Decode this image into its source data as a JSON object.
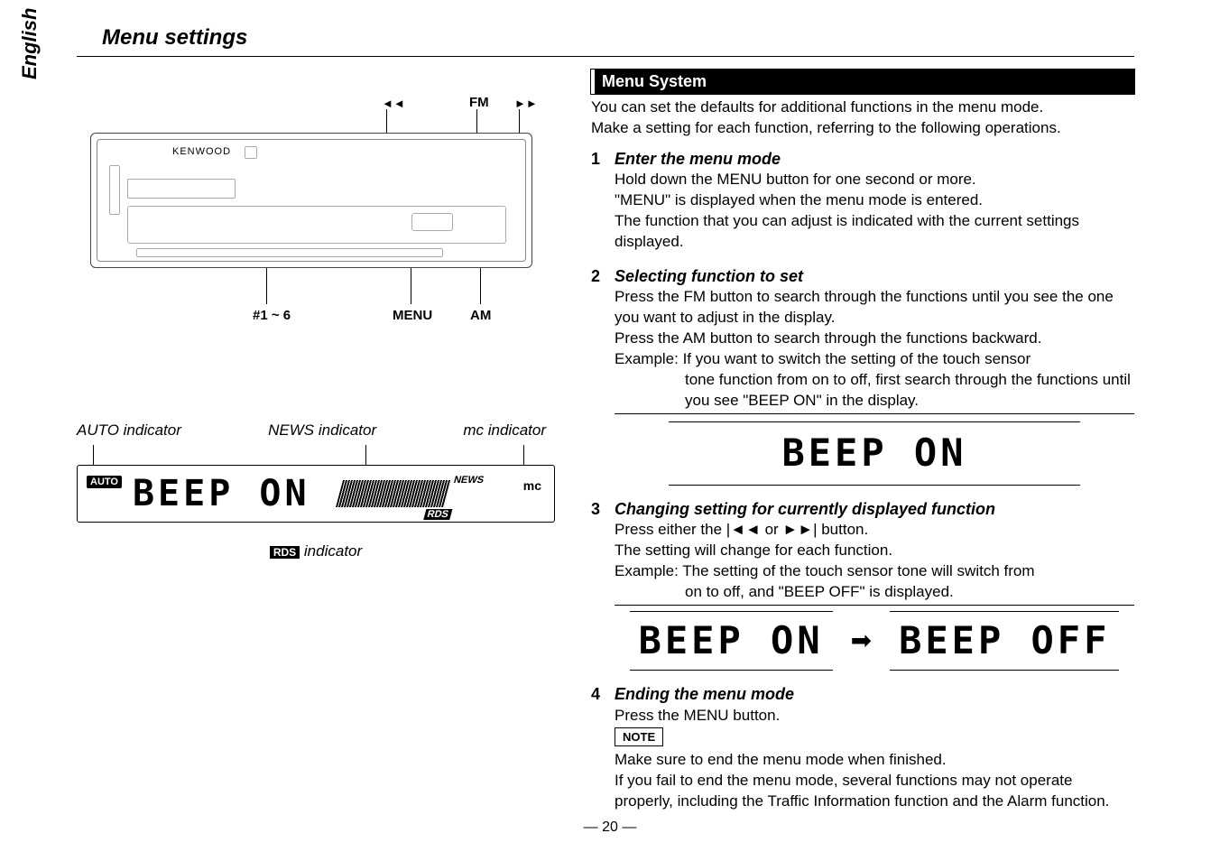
{
  "tab": "English",
  "section_title": "Menu settings",
  "device": {
    "brand": "KENWOOD",
    "top_labels": {
      "prev": "◄◄",
      "fm": "FM",
      "next": "►►"
    },
    "bottom_labels": {
      "presets": "#1 ~ 6",
      "menu": "MENU",
      "am": "AM"
    }
  },
  "display": {
    "ind1": "AUTO indicator",
    "ind2": "NEWS indicator",
    "ind3": "mc indicator",
    "auto_badge": "AUTO",
    "seg_text": "BEEP  ON",
    "news": "NEWS",
    "rds": "RDS",
    "mc": "mc",
    "rds_caption_badge": "RDS",
    "rds_caption_text": " indicator"
  },
  "menu": {
    "header": "Menu System",
    "intro": "You can set the defaults for additional functions in the menu mode.\nMake a setting for each function, referring to the following operations.",
    "steps": [
      {
        "num": "1",
        "title": "Enter the menu mode",
        "body": "Hold down the MENU button for one second or more.\n\"MENU\" is displayed when the menu mode is entered.\nThe function that you can adjust is indicated with the current settings displayed."
      },
      {
        "num": "2",
        "title": "Selecting function to set",
        "body": "Press the FM button to search through the functions until you see the one you want to adjust in the display.\nPress the AM button to search through the functions backward.\nExample: If you want to switch the setting of the touch sensor",
        "example_cont": "tone function from on to off, first search through the functions until you see \"BEEP ON\" in the display.",
        "seg": "BEEP  ON"
      },
      {
        "num": "3",
        "title": "Changing setting for currently displayed function",
        "body_pre": "Press either the ",
        "body_mid": " or ",
        "body_post": " button.\nThe setting will change for each function.\nExample: The setting of the touch sensor tone will switch from",
        "example_cont": "on to off, and \"BEEP OFF\" is displayed.",
        "seg_a": "BEEP  ON",
        "seg_b": "BEEP OFF"
      },
      {
        "num": "4",
        "title": "Ending the menu mode",
        "body": "Press the MENU button.",
        "note_label": "NOTE",
        "note_body": "Make sure to end the menu mode when finished.\nIf you fail to end the menu mode, several functions may not operate properly, including the Traffic Information function and the Alarm function."
      }
    ]
  },
  "icons": {
    "prev": "|◄◄",
    "next": "►►|",
    "arrow": "➡"
  },
  "page_number": "— 20 —"
}
